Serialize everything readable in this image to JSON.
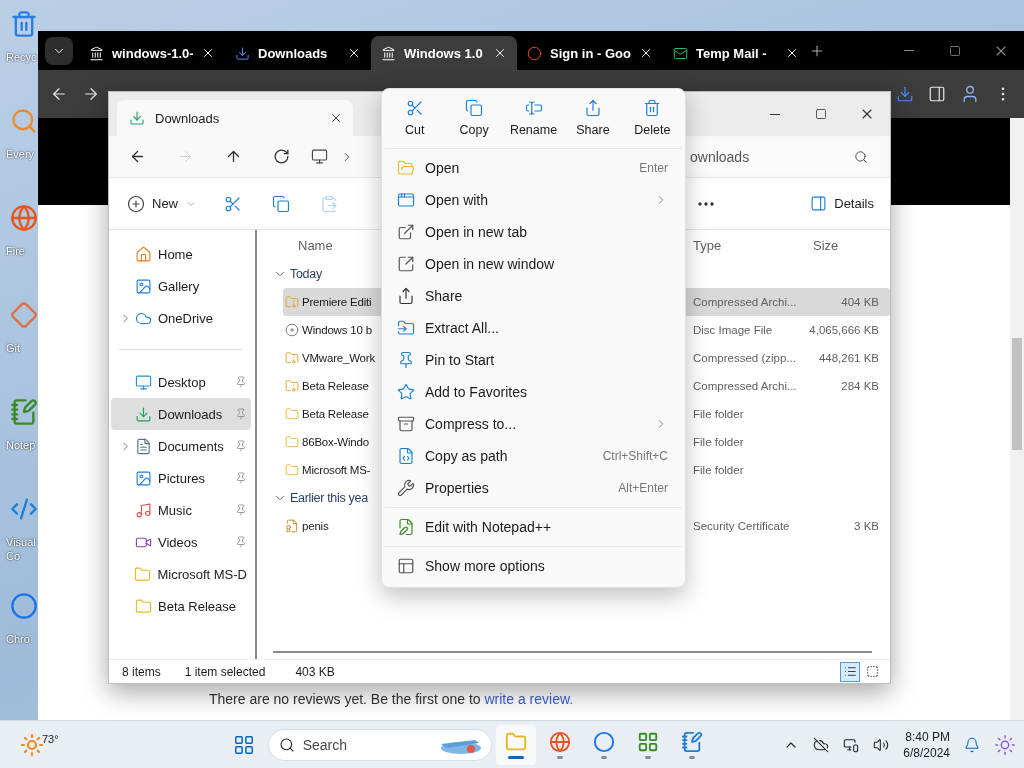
{
  "desktop_icons": [
    {
      "kind": "trash",
      "label": "Recyc"
    },
    {
      "kind": "search",
      "label": "Every"
    },
    {
      "kind": "globe",
      "label": "Fire"
    },
    {
      "kind": "diamond",
      "label": "Git"
    },
    {
      "kind": "notepad",
      "label": "Notep"
    },
    {
      "kind": "code",
      "label": "Visual Co"
    },
    {
      "kind": "ring",
      "label": "Chro"
    }
  ],
  "browser": {
    "tabs": [
      {
        "kind": "archive",
        "title": "windows-1.0-",
        "selected": false
      },
      {
        "kind": "download",
        "title": "Downloads",
        "selected": false
      },
      {
        "kind": "archive",
        "title": "Windows 1.0",
        "selected": true
      },
      {
        "kind": "google",
        "title": "Sign in - Goo",
        "selected": false
      },
      {
        "kind": "mail",
        "title": "Temp Mail - ",
        "selected": false
      }
    ],
    "page": {
      "review_text": "There are no reviews yet. Be the first one to ",
      "review_link": "write a review."
    }
  },
  "explorer": {
    "tab": "Downloads",
    "nav": [
      {
        "kind": "back",
        "disabled": false
      },
      {
        "kind": "forward",
        "disabled": true
      },
      {
        "kind": "up",
        "disabled": false
      },
      {
        "kind": "refresh",
        "disabled": false
      }
    ],
    "search": "ownloads",
    "commands": [
      {
        "kind": "new",
        "label": "New",
        "disabled": false
      },
      {
        "kind": "cut",
        "disabled": false
      },
      {
        "kind": "copy",
        "disabled": false
      },
      {
        "kind": "paste",
        "disabled": true
      }
    ],
    "details_label": "Details",
    "sidebar": {
      "groups": [
        {
          "items": [
            {
              "kind": "home",
              "label": "Home",
              "selected": false,
              "pinned": false,
              "expander": false
            },
            {
              "kind": "gallery",
              "label": "Gallery",
              "selected": false,
              "pinned": false,
              "expander": false
            },
            {
              "kind": "cloud",
              "label": "OneDrive",
              "selected": false,
              "pinned": false,
              "expander": true
            }
          ]
        },
        {
          "items": [
            {
              "kind": "desktop",
              "label": "Desktop",
              "selected": false,
              "pinned": true,
              "expander": false
            },
            {
              "kind": "download",
              "label": "Downloads",
              "selected": true,
              "pinned": true,
              "expander": false
            },
            {
              "kind": "documents",
              "label": "Documents",
              "selected": false,
              "pinned": true,
              "expander": true
            },
            {
              "kind": "pictures",
              "label": "Pictures",
              "selected": false,
              "pinned": true,
              "expander": false
            },
            {
              "kind": "music",
              "label": "Music",
              "selected": false,
              "pinned": true,
              "expander": false
            },
            {
              "kind": "videos",
              "label": "Videos",
              "selected": false,
              "pinned": true,
              "expander": false
            },
            {
              "kind": "folder",
              "label": "Microsoft MS-D",
              "selected": false,
              "pinned": false,
              "expander": false
            },
            {
              "kind": "folder",
              "label": "Beta Release",
              "selected": false,
              "pinned": false,
              "expander": false
            }
          ]
        }
      ]
    },
    "columns": {
      "name": "Name",
      "type": "Type",
      "size": "Size"
    },
    "groups": [
      {
        "label": "Today",
        "expanded": true,
        "files": [
          {
            "kind": "zip",
            "name": "Premiere Editi",
            "type": "Compressed Archi...",
            "size": "404 KB",
            "selected": true
          },
          {
            "kind": "disc",
            "name": "Windows 10 b",
            "type": "Disc Image File",
            "size": "4,065,666 KB",
            "selected": false
          },
          {
            "kind": "zip",
            "name": "VMware_Work",
            "type": "Compressed (zipp...",
            "size": "448,261 KB",
            "selected": false
          },
          {
            "kind": "zip",
            "name": "Beta Release",
            "type": "Compressed Archi...",
            "size": "284 KB",
            "selected": false
          },
          {
            "kind": "folder",
            "name": "Beta Release",
            "type": "File folder",
            "selected": false
          },
          {
            "kind": "folder",
            "name": "86Box-Windo",
            "type": "File folder",
            "selected": false
          },
          {
            "kind": "folder",
            "name": "Microsoft MS-",
            "type": "File folder",
            "selected": false
          }
        ]
      },
      {
        "label": "Earlier this yea",
        "expanded": true,
        "files": [
          {
            "kind": "certificate",
            "name": "penis",
            "type": "Security Certificate",
            "size": "3 KB",
            "selected": false
          }
        ]
      }
    ],
    "status": {
      "count": "8 items",
      "selection": "1 item selected",
      "size": "403 KB"
    },
    "views": [
      {
        "kind": "details",
        "selected": true
      },
      {
        "kind": "tiles",
        "selected": false
      }
    ]
  },
  "context_menu": {
    "quick_actions": [
      {
        "kind": "cut",
        "label": "Cut"
      },
      {
        "kind": "copy",
        "label": "Copy"
      },
      {
        "kind": "rename",
        "label": "Rename"
      },
      {
        "kind": "share",
        "label": "Share"
      },
      {
        "kind": "delete",
        "label": "Delete"
      }
    ],
    "sections": [
      [
        {
          "kind": "open",
          "label": "Open",
          "shortcut": "Enter",
          "submenu": false
        },
        {
          "kind": "openwith",
          "label": "Open with",
          "submenu": true
        },
        {
          "kind": "newtab",
          "label": "Open in new tab",
          "submenu": false
        },
        {
          "kind": "newwindow",
          "label": "Open in new window",
          "submenu": false
        },
        {
          "kind": "share",
          "label": "Share",
          "submenu": false
        },
        {
          "kind": "extract",
          "label": "Extract All...",
          "submenu": false
        },
        {
          "kind": "pin",
          "label": "Pin to Start",
          "submenu": false
        },
        {
          "kind": "star",
          "label": "Add to Favorites",
          "submenu": false
        },
        {
          "kind": "compress",
          "label": "Compress to...",
          "submenu": true
        },
        {
          "kind": "path",
          "label": "Copy as path",
          "shortcut": "Ctrl+Shift+C",
          "submenu": false
        },
        {
          "kind": "properties",
          "label": "Properties",
          "shortcut": "Alt+Enter",
          "submenu": false
        }
      ],
      [
        {
          "kind": "notepad",
          "label": "Edit with Notepad++",
          "submenu": false
        }
      ],
      [
        {
          "kind": "more",
          "label": "Show more options",
          "submenu": false
        }
      ]
    ]
  },
  "taskbar": {
    "weather": "73°",
    "search_placeholder": "Search",
    "apps": [
      {
        "kind": "explorer",
        "selected": true
      },
      {
        "kind": "firefox",
        "selected": false
      },
      {
        "kind": "chrome",
        "selected": false
      },
      {
        "kind": "tool",
        "selected": false
      },
      {
        "kind": "notepad",
        "selected": false
      }
    ],
    "time": "8:40 PM",
    "date": "6/8/2024"
  }
}
